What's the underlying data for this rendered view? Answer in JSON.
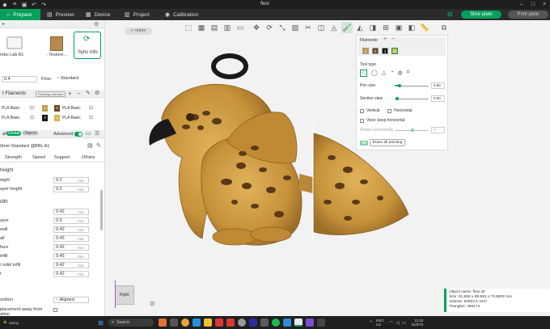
{
  "window": {
    "title": "flexi"
  },
  "nav": {
    "tabs": [
      {
        "label": "Prepare",
        "icon": "home-icon"
      },
      {
        "label": "Preview",
        "icon": "preview-icon"
      },
      {
        "label": "Device",
        "icon": "device-icon"
      },
      {
        "label": "Project",
        "icon": "project-icon"
      },
      {
        "label": "Calibration",
        "icon": "calibration-icon"
      }
    ],
    "slice_label": "Slice plate",
    "print_label": "Print plate"
  },
  "printer": {
    "name": "mbu Lab A1",
    "plate_label": "- Texture...",
    "sync_label": "Sync info",
    "nozzle_value": "0.4",
    "flow_label": "Flow:",
    "flow_value": "Standard"
  },
  "filaments": {
    "header": "t Filaments",
    "badge": "Flushing volumes",
    "items": [
      {
        "num": "1",
        "name": "PLA Basic",
        "color": "#c79a4a"
      },
      {
        "num": "2",
        "name": "PLA Basic",
        "color": "#6b4a22"
      },
      {
        "num": "3",
        "name": "PLA Basic",
        "color": "#111111"
      },
      {
        "num": "4",
        "name": "PLA Basic",
        "color": "#d8b848"
      }
    ]
  },
  "process": {
    "header": "al",
    "global_label": "Global",
    "objects_label": "Objects",
    "advanced_label": "Advanced",
    "profile": "0mm Standard @BBL A1",
    "tabs": [
      "Strength",
      "Speed",
      "Support",
      "Others"
    ],
    "layer_height_title": "height",
    "layer_rows": [
      {
        "label": "eight",
        "value": "0.2",
        "unit": "mm"
      },
      {
        "label": "ayer height",
        "value": "0.2",
        "unit": "mm"
      }
    ],
    "line_width_title": "idth",
    "width_rows": [
      {
        "label": "",
        "value": "0.42",
        "unit": "mm"
      },
      {
        "label": "ayer",
        "value": "0.5",
        "unit": "mm"
      },
      {
        "label": "wall",
        "value": "0.42",
        "unit": "mm"
      },
      {
        "label": "all",
        "value": "0.45",
        "unit": "mm"
      },
      {
        "label": "face",
        "value": "0.42",
        "unit": "mm"
      },
      {
        "label": "infill",
        "value": "0.45",
        "unit": "mm"
      },
      {
        "label": "/ solid infill",
        "value": "0.42",
        "unit": "mm"
      },
      {
        "label": "t",
        "value": "0.42",
        "unit": "mm"
      }
    ],
    "seam_label": "osition",
    "seam_value": "Aligned",
    "placement_label1": "placement away from",
    "placement_label2": "ation"
  },
  "viewport": {
    "return_label": "return",
    "view_label": "Right"
  },
  "paint": {
    "filaments_label": "Filaments",
    "tool_type_label": "Tool type",
    "pen_size_label": "Pen size",
    "pen_size_value": "0.84",
    "section_view_label": "Section view",
    "section_view_value": "0.00",
    "vertical_label": "Vertical",
    "horizontal_label": "Horizontal",
    "view_keep_label": "View: keep horizontal",
    "rotate_label": "Rotate horizontally",
    "rotate_value": "0",
    "erase_label": "Erase all painting",
    "swatch_nums": [
      "1",
      "2",
      "3",
      "4"
    ]
  },
  "status": {
    "object_name": "Object name: flexi.stl",
    "size": "Size: 51.656 x 99.991 x 73.8802 mm",
    "volume": "Volume: 82834.1 mm³",
    "triangles": "Triangles: 269174"
  },
  "taskbar": {
    "weather": "sunny",
    "search_placeholder": "Search",
    "lang1": "ENG",
    "lang2": "US",
    "time": "11:02",
    "date": "31/07/2"
  },
  "colors": {
    "accent": "#00a05a",
    "bird_body": "#c99a3f",
    "spots": "#5a3a18"
  }
}
